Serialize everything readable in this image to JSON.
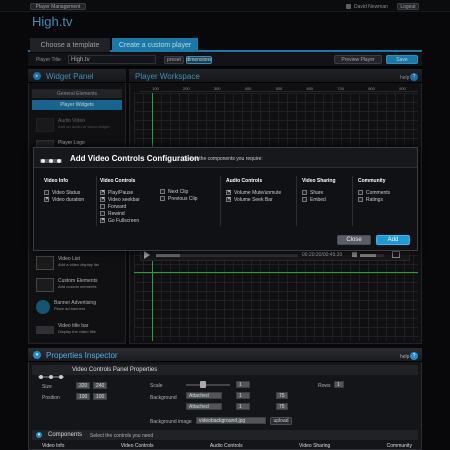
{
  "top": {
    "player_management": "Player Management",
    "user_name": "David Newman",
    "logout": "Logout"
  },
  "app_title": "High.tv",
  "tabs": [
    "Choose a template",
    "Create a custom player"
  ],
  "player_bar": {
    "title_label": "Player Title",
    "title_value": "High.tv",
    "btn_small": "preset",
    "btn_dims": "dimensions",
    "preview": "Preview Player",
    "save": "Save"
  },
  "widget_panel": {
    "title": "Widget Panel",
    "general_elements": "General Elements",
    "player_widgets": "Player Widgets"
  },
  "workspace": {
    "title": "Player Workspace",
    "help": "help",
    "ruler": [
      "100",
      "200",
      "300",
      "400",
      "500",
      "600",
      "700",
      "800",
      "900"
    ],
    "time": "00:20:20/00:45:20"
  },
  "sidebar_items": [
    {
      "title": "Audio Video",
      "sub": "Add an audio or video widget"
    },
    {
      "title": "Player Logo",
      "sub": ""
    },
    {
      "title": "Video List",
      "sub": "Add a video display list"
    },
    {
      "title": "Custom Elements",
      "sub": "Add custom elements"
    },
    {
      "title": "Banner Advertising",
      "sub": "Place ad banners"
    },
    {
      "title": "Video title bar",
      "sub": "Display the video title"
    }
  ],
  "modal": {
    "title": "Add Video Controls Configuration",
    "subtitle": "Select the components you require:",
    "columns": [
      {
        "header": "Video Info",
        "items": [
          {
            "label": "Video Status",
            "checked": false
          },
          {
            "label": "Video duration",
            "checked": true
          }
        ]
      },
      {
        "header": "Video Controls",
        "items": [
          {
            "label": "Play/Pause",
            "checked": true
          },
          {
            "label": "Video seekbar",
            "checked": true
          },
          {
            "label": "Forward",
            "checked": false
          },
          {
            "label": "Rewind",
            "checked": false
          },
          {
            "label": "Go Fullscreen",
            "checked": true
          }
        ]
      },
      {
        "header": "",
        "items": [
          {
            "label": "Next Clip",
            "checked": false
          },
          {
            "label": "Previous Clip",
            "checked": false
          }
        ]
      },
      {
        "header": "Audio Controls",
        "items": [
          {
            "label": "Volume Mute/unmute",
            "checked": true
          },
          {
            "label": "Volume Seek Bar",
            "checked": true
          }
        ]
      },
      {
        "header": "Video Sharing",
        "items": [
          {
            "label": "Share",
            "checked": false
          },
          {
            "label": "Embed",
            "checked": false
          }
        ]
      },
      {
        "header": "Community",
        "items": [
          {
            "label": "Comments",
            "checked": false
          },
          {
            "label": "Ratings",
            "checked": false
          }
        ]
      }
    ],
    "close": "Close",
    "add": "Add"
  },
  "properties": {
    "title": "Properties Inspector",
    "help": "help",
    "panel_title": "Video Controls Panel Properties",
    "size_label": "Size",
    "size_w": "320",
    "size_h": "240",
    "position_label": "Position",
    "pos_x": "100",
    "pos_y": "100",
    "scale_label": "Scale",
    "scale_value": "1",
    "background_label": "Background",
    "bg_select": "Attached",
    "bg_value": "1",
    "bg_pct": "75",
    "bgimage_label": "Background image",
    "bgimage_value": "videobackground.jpg",
    "upload": "upload",
    "rows_label": "Rows",
    "rows_value": "1",
    "components_title": "Components",
    "components_sub": "Select the controls you need",
    "bottom_cols": [
      "Video Info",
      "Video Controls",
      "Audio Controls",
      "Video Sharing",
      "Community"
    ]
  },
  "colors": {
    "accent": "#1c9ad6",
    "modal_bg": "#101114",
    "green_guide": "#2ecc40"
  }
}
